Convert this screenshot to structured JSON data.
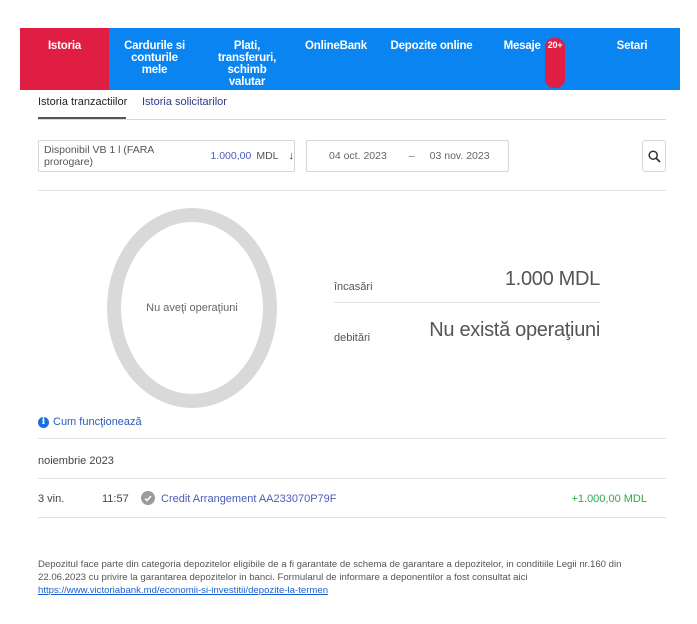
{
  "nav": {
    "tabs": [
      {
        "label": "Istoria"
      },
      {
        "label": "Cardurile si conturile mele"
      },
      {
        "label": "Plati, transferuri, schimb valutar"
      },
      {
        "label": "OnlineBank"
      },
      {
        "label": "Depozite online"
      },
      {
        "label": "Mesaje",
        "badge": "20+"
      },
      {
        "label": "Setari"
      }
    ],
    "active_color": "#e01e43",
    "bar_color": "#0a84f0"
  },
  "subtabs": [
    "Istoria tranzactiilor",
    "Istoria solicitarilor"
  ],
  "filter": {
    "account": "Disponibil VB 1 l (FARA prorogare)",
    "amount": "1.000,00",
    "currency": "MDL",
    "arrow": "↓",
    "date_from": "04 oct. 2023",
    "separator": "–",
    "date_to": "03 nov. 2023",
    "search_icon": "search-icon"
  },
  "summary": {
    "chart_label": "Nu aveţi operaţiuni",
    "income_label": "încasări",
    "income_value": "1.000 MDL",
    "debit_label": "debitări",
    "debit_value": "Nu există operaţiuni"
  },
  "how_it_works": "Cum funcţionează",
  "transactions": {
    "month": "noiembrie 2023",
    "rows": [
      {
        "day": "3 vin.",
        "time": "11:57",
        "description": "Credit Arrangement AA233070P79F",
        "amount": "+1.000,00 MDL"
      }
    ]
  },
  "disclaimer": {
    "text": "Depozitul face parte din categoria depozitelor eligibile de a fi garantate de schema de garantare a depozitelor, in conditiile Legii nr.160 din 22.06.2023 cu privire la garantarea depozitelor in banci. Formularul de informare a deponentilor a fost consultat aici",
    "link": "https://www.victoriabank.md/economii-si-investitii/depozite-la-termen"
  }
}
